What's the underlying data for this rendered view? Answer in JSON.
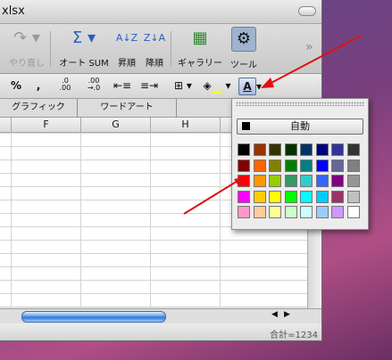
{
  "window": {
    "title": "xlsx"
  },
  "toolbar": {
    "redo_label": "やり直し",
    "autosum_label": "オート SUM",
    "sort_asc_label": "昇順",
    "sort_desc_label": "降順",
    "gallery_label": "ギャラリー",
    "tools_label": "ツール",
    "overflow": "»"
  },
  "format_bar": {
    "percent": "%",
    "comma": ",",
    "dec_increase_top": ".0",
    "dec_increase_bottom": ".00",
    "dec_decrease_top": ".00",
    "dec_decrease_bottom": "→.0"
  },
  "tabs": [
    "グラフィック",
    "ワードアート"
  ],
  "columns": [
    "F",
    "G",
    "H"
  ],
  "status": {
    "sum_label": "合計=1234"
  },
  "palette": {
    "auto_label": "自動",
    "rows": [
      [
        "#000000",
        "#993300",
        "#333300",
        "#003300",
        "#003366",
        "#000080",
        "#333399",
        "#333333"
      ],
      [
        "#800000",
        "#ff6600",
        "#808000",
        "#008000",
        "#008080",
        "#0000ff",
        "#666699",
        "#808080"
      ],
      [
        "#ff0000",
        "#ff9900",
        "#99cc00",
        "#339966",
        "#33cccc",
        "#3366ff",
        "#800080",
        "#969696"
      ],
      [
        "#ff00ff",
        "#ffcc00",
        "#ffff00",
        "#00ff00",
        "#00ffff",
        "#00ccff",
        "#993366",
        "#c0c0c0"
      ],
      [
        "#ff99cc",
        "#ffcc99",
        "#ffff99",
        "#ccffcc",
        "#ccffff",
        "#99ccff",
        "#cc99ff",
        "#ffffff"
      ]
    ]
  },
  "colors": {
    "arrow": "#e01010",
    "font_color_bar": "#ffff00"
  }
}
